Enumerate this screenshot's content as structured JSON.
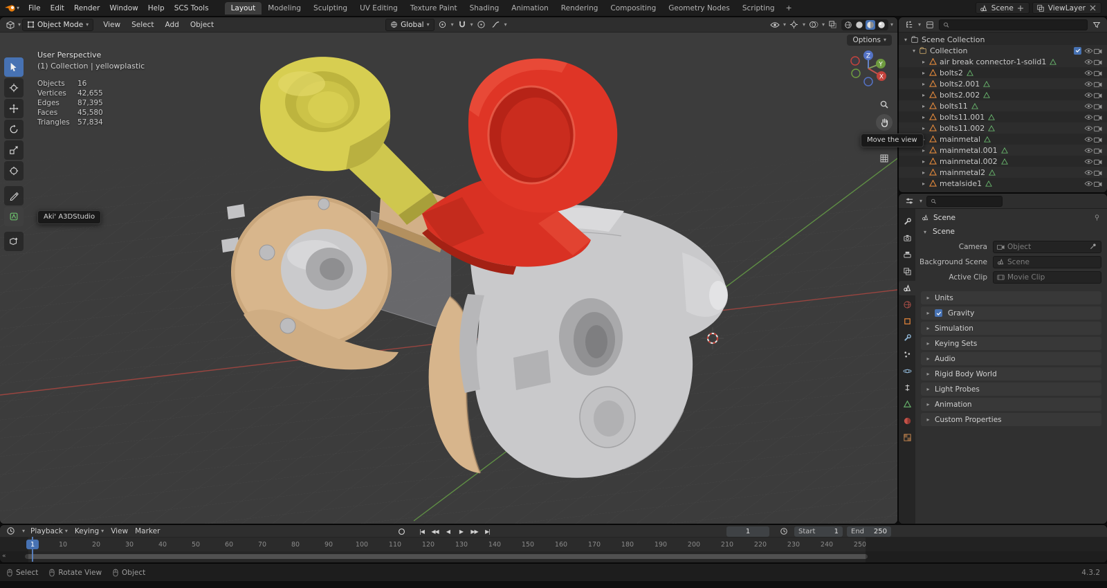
{
  "topbar": {
    "menus": [
      "File",
      "Edit",
      "Render",
      "Window",
      "Help",
      "SCS Tools"
    ],
    "workspaces": [
      "Layout",
      "Modeling",
      "Sculpting",
      "UV Editing",
      "Texture Paint",
      "Shading",
      "Animation",
      "Rendering",
      "Compositing",
      "Geometry Nodes",
      "Scripting"
    ],
    "active_workspace": "Layout",
    "add_workspace": "+",
    "scene_name": "Scene",
    "viewlayer_name": "ViewLayer"
  },
  "viewport": {
    "header": {
      "mode": "Object Mode",
      "menus": [
        "View",
        "Select",
        "Add",
        "Object"
      ],
      "orientation": "Global",
      "options_button": "Options"
    },
    "overlay": {
      "view_name": "User Perspective",
      "context": "(1) Collection | yellowplastic",
      "stats": [
        {
          "label": "Objects",
          "value": "16"
        },
        {
          "label": "Vertices",
          "value": "42,655"
        },
        {
          "label": "Edges",
          "value": "87,395"
        },
        {
          "label": "Faces",
          "value": "45,580"
        },
        {
          "label": "Triangles",
          "value": "57,834"
        }
      ]
    },
    "gizmo": {
      "x": "X",
      "y": "Y",
      "z": "Z"
    },
    "tool_tooltip": "Aki' A3DStudio",
    "nav_tooltip": "Move the view",
    "colors": {
      "accent": "#4772b3",
      "axis_x": "#9a4540",
      "axis_y": "#5f8f44",
      "plastic_yellow": "#d7ce51",
      "plastic_red": "#df3526",
      "metal_tan": "#d8b68c",
      "metal_gray": "#c9c9cb"
    }
  },
  "outliner": {
    "scene_collection": "Scene Collection",
    "collection": "Collection",
    "objects": [
      "air break connector-1-solid1",
      "bolts2",
      "bolts2.001",
      "bolts2.002",
      "bolts11",
      "bolts11.001",
      "bolts11.002",
      "mainmetal",
      "mainmetal.001",
      "mainmetal.002",
      "mainmetal2",
      "metalside1"
    ]
  },
  "properties": {
    "breadcrumb": "Scene",
    "scene_section": "Scene",
    "fields": {
      "camera_label": "Camera",
      "camera_value": "Object",
      "background_label": "Background Scene",
      "background_value": "Scene",
      "clip_label": "Active Clip",
      "clip_value": "Movie Clip"
    },
    "sections_top": [
      "Units"
    ],
    "gravity": "Gravity",
    "sections_bottom": [
      "Simulation",
      "Keying Sets",
      "Audio",
      "Rigid Body World",
      "Light Probes",
      "Animation",
      "Custom Properties"
    ]
  },
  "timeline": {
    "menus_dropdown": [
      "Playback",
      "Keying"
    ],
    "menus_plain": [
      "View",
      "Marker"
    ],
    "current_frame": "1",
    "start_label": "Start",
    "start_value": "1",
    "end_label": "End",
    "end_value": "250",
    "ticks": [
      "10",
      "20",
      "30",
      "40",
      "50",
      "60",
      "70",
      "80",
      "90",
      "100",
      "110",
      "120",
      "130",
      "140",
      "150",
      "160",
      "170",
      "180",
      "190",
      "200",
      "210",
      "220",
      "230",
      "240",
      "250"
    ]
  },
  "statusbar": {
    "items": [
      "Select",
      "Rotate View",
      "Object"
    ],
    "version": "4.3.2"
  }
}
